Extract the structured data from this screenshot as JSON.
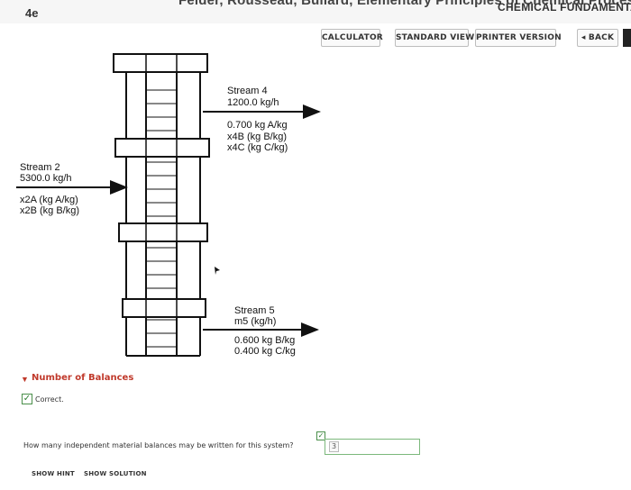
{
  "header": {
    "book_title": "Felder, Rousseau, Bullard, Elementary Principles of Chemical Processes,",
    "section_label": "4e",
    "brand": "CHEMICAL FUNDAMENTALS"
  },
  "toolbar": {
    "calculator": "CALCULATOR",
    "standard_view": "STANDARD VIEW",
    "printer_version": "PRINTER VERSION",
    "back": "◂ BACK"
  },
  "diagram": {
    "stream4": {
      "name": "Stream 4",
      "flow": "1200.0 kg/h",
      "line1": "0.700 kg A/kg",
      "line2": "x4B (kg B/kg)",
      "line3": "x4C (kg C/kg)"
    },
    "stream2": {
      "name": "Stream 2",
      "flow": "5300.0 kg/h",
      "line1": "x2A (kg A/kg)",
      "line2": "x2B (kg B/kg)"
    },
    "stream5": {
      "name": "Stream 5",
      "flow": "m5 (kg/h)",
      "line1": "0.600 kg B/kg",
      "line2": "0.400 kg C/kg"
    }
  },
  "balances": {
    "title": "Number of Balances",
    "status": "Correct.",
    "question": "How many independent material balances may be written for this system?",
    "answer": "3"
  },
  "buttons": {
    "show_hint": "SHOW HINT",
    "show_solution": "SHOW SOLUTION"
  },
  "colors": {
    "accent_red": "#c0392b",
    "correct_green": "#2e7d32"
  }
}
